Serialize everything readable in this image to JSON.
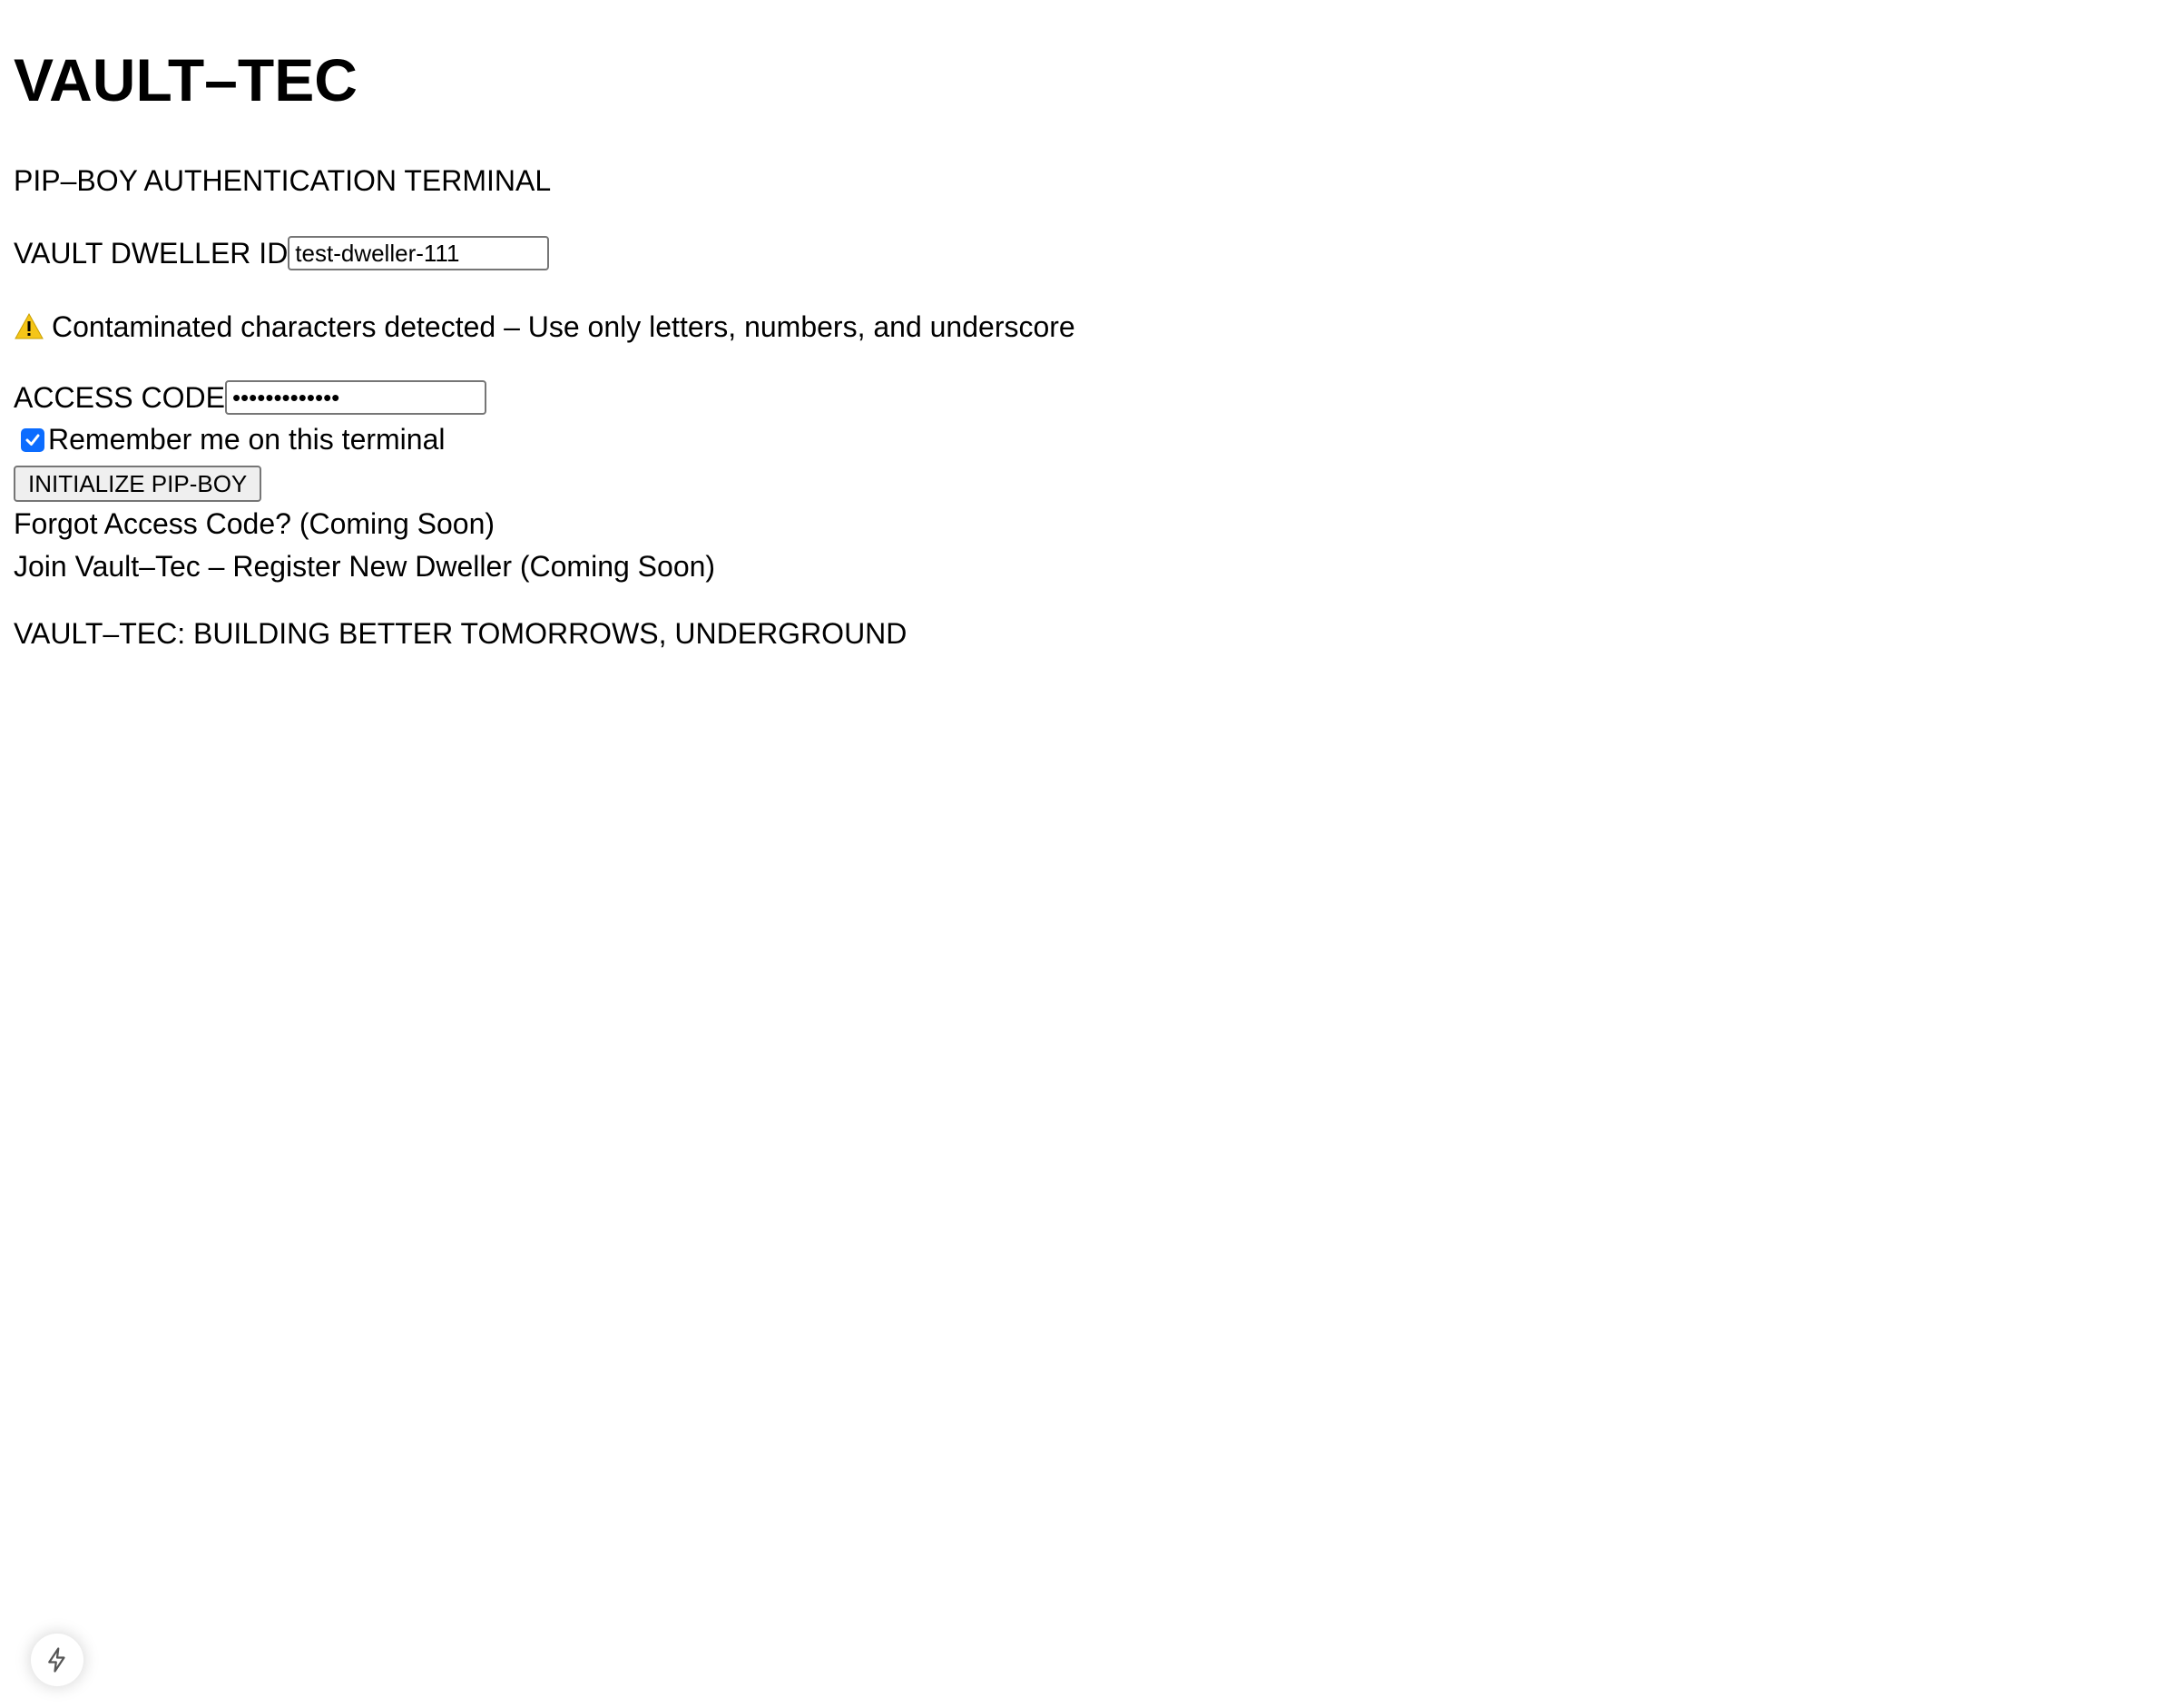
{
  "header": {
    "title": "VAULT–TEC",
    "subtitle": "PIP–BOY AUTHENTICATION TERMINAL"
  },
  "form": {
    "dweller_id_label": "VAULT DWELLER ID",
    "dweller_id_value": "test-dweller-111",
    "warning_icon": "warning-icon",
    "warning_text": "Contaminated characters detected – Use only letters, numbers, and underscore",
    "access_code_label": "ACCESS CODE",
    "access_code_value": "•••••••••••••",
    "remember_label": "Remember me on this terminal",
    "remember_checked": true,
    "submit_label": "INITIALIZE PIP-BOY"
  },
  "links": {
    "forgot": "Forgot Access Code? (Coming Soon)",
    "join": "Join Vault–Tec – Register New Dweller (Coming Soon)"
  },
  "footer": {
    "tagline": "VAULT–TEC: BUILDING BETTER TOMORROWS, UNDERGROUND"
  },
  "floating_button": {
    "icon": "lightning-bolt-icon"
  },
  "colors": {
    "checkbox_accent": "#0b6cff",
    "warning_yellow": "#f5c518"
  }
}
